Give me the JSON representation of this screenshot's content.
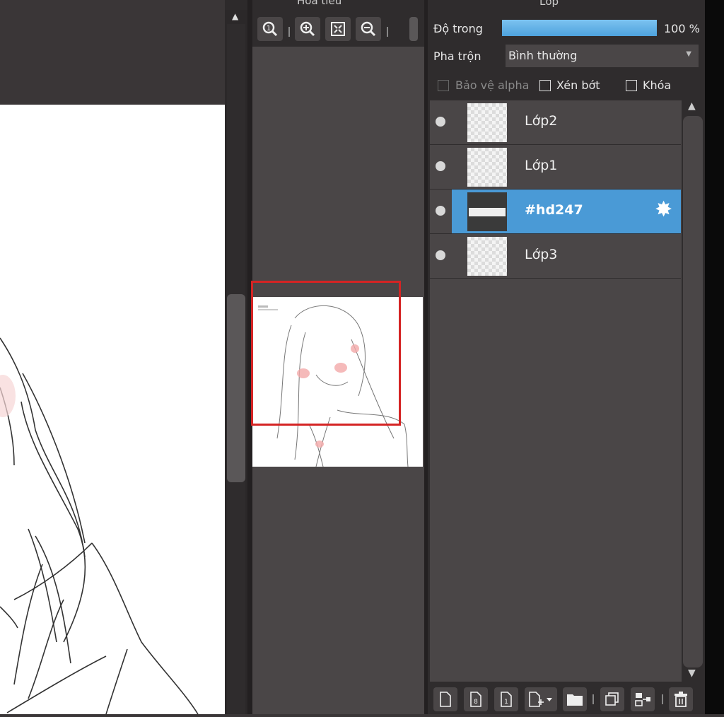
{
  "navigator": {
    "title": "Hoa tieu",
    "tools": {
      "zoom_reset": "⊕",
      "zoom_in": "⊕",
      "fit": "⛶",
      "zoom_out": "⊖"
    }
  },
  "layer_panel": {
    "title": "Lớp",
    "opacity_label": "Độ trong",
    "opacity_value": 100,
    "opacity_text": "100 %",
    "blend_label": "Pha trộn",
    "blend_value": "Bình thường",
    "protect_alpha_label": "Bảo vệ alpha",
    "clipping_label": "Xén bớt",
    "lock_label": "Khóa",
    "layers": [
      {
        "name": "Lớp2",
        "active": false
      },
      {
        "name": "Lớp1",
        "active": false
      },
      {
        "name": "#hd247",
        "active": true
      },
      {
        "name": "Lớp3",
        "active": false
      }
    ]
  },
  "colors": {
    "accent": "#4a9ad6",
    "navigator_frame": "#d42424",
    "panel_bg": "#4a4647",
    "dark_bg": "#2f2c2d"
  },
  "icons": {
    "new_layer": "new-layer-icon",
    "new_8bit": "new-8bit-layer-icon",
    "new_1bit": "new-1bit-layer-icon",
    "add_menu": "add-layer-menu-icon",
    "folder": "folder-icon",
    "duplicate": "duplicate-layer-icon",
    "merge": "merge-layer-icon",
    "delete": "trash-icon"
  }
}
